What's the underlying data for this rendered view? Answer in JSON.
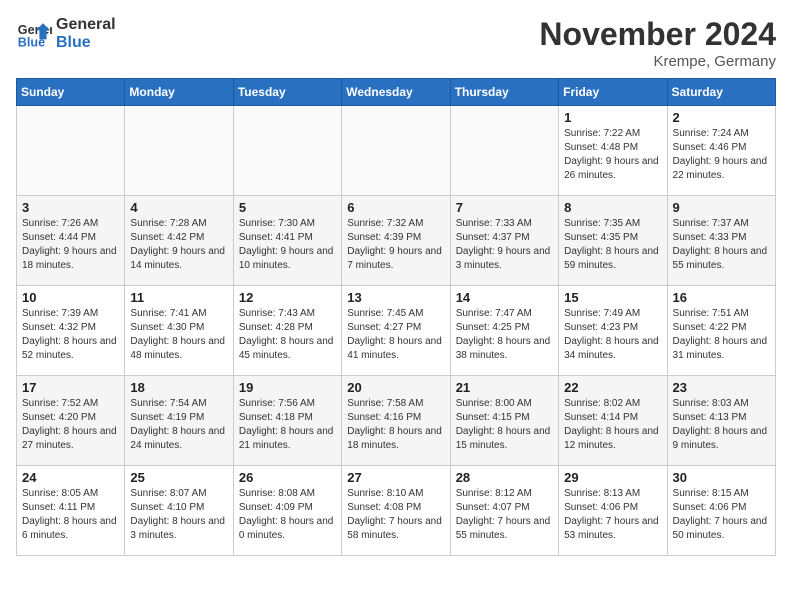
{
  "logo": {
    "text_general": "General",
    "text_blue": "Blue"
  },
  "header": {
    "month": "November 2024",
    "location": "Krempe, Germany"
  },
  "days_of_week": [
    "Sunday",
    "Monday",
    "Tuesday",
    "Wednesday",
    "Thursday",
    "Friday",
    "Saturday"
  ],
  "weeks": [
    [
      {
        "day": "",
        "info": ""
      },
      {
        "day": "",
        "info": ""
      },
      {
        "day": "",
        "info": ""
      },
      {
        "day": "",
        "info": ""
      },
      {
        "day": "",
        "info": ""
      },
      {
        "day": "1",
        "info": "Sunrise: 7:22 AM\nSunset: 4:48 PM\nDaylight: 9 hours and 26 minutes."
      },
      {
        "day": "2",
        "info": "Sunrise: 7:24 AM\nSunset: 4:46 PM\nDaylight: 9 hours and 22 minutes."
      }
    ],
    [
      {
        "day": "3",
        "info": "Sunrise: 7:26 AM\nSunset: 4:44 PM\nDaylight: 9 hours and 18 minutes."
      },
      {
        "day": "4",
        "info": "Sunrise: 7:28 AM\nSunset: 4:42 PM\nDaylight: 9 hours and 14 minutes."
      },
      {
        "day": "5",
        "info": "Sunrise: 7:30 AM\nSunset: 4:41 PM\nDaylight: 9 hours and 10 minutes."
      },
      {
        "day": "6",
        "info": "Sunrise: 7:32 AM\nSunset: 4:39 PM\nDaylight: 9 hours and 7 minutes."
      },
      {
        "day": "7",
        "info": "Sunrise: 7:33 AM\nSunset: 4:37 PM\nDaylight: 9 hours and 3 minutes."
      },
      {
        "day": "8",
        "info": "Sunrise: 7:35 AM\nSunset: 4:35 PM\nDaylight: 8 hours and 59 minutes."
      },
      {
        "day": "9",
        "info": "Sunrise: 7:37 AM\nSunset: 4:33 PM\nDaylight: 8 hours and 55 minutes."
      }
    ],
    [
      {
        "day": "10",
        "info": "Sunrise: 7:39 AM\nSunset: 4:32 PM\nDaylight: 8 hours and 52 minutes."
      },
      {
        "day": "11",
        "info": "Sunrise: 7:41 AM\nSunset: 4:30 PM\nDaylight: 8 hours and 48 minutes."
      },
      {
        "day": "12",
        "info": "Sunrise: 7:43 AM\nSunset: 4:28 PM\nDaylight: 8 hours and 45 minutes."
      },
      {
        "day": "13",
        "info": "Sunrise: 7:45 AM\nSunset: 4:27 PM\nDaylight: 8 hours and 41 minutes."
      },
      {
        "day": "14",
        "info": "Sunrise: 7:47 AM\nSunset: 4:25 PM\nDaylight: 8 hours and 38 minutes."
      },
      {
        "day": "15",
        "info": "Sunrise: 7:49 AM\nSunset: 4:23 PM\nDaylight: 8 hours and 34 minutes."
      },
      {
        "day": "16",
        "info": "Sunrise: 7:51 AM\nSunset: 4:22 PM\nDaylight: 8 hours and 31 minutes."
      }
    ],
    [
      {
        "day": "17",
        "info": "Sunrise: 7:52 AM\nSunset: 4:20 PM\nDaylight: 8 hours and 27 minutes."
      },
      {
        "day": "18",
        "info": "Sunrise: 7:54 AM\nSunset: 4:19 PM\nDaylight: 8 hours and 24 minutes."
      },
      {
        "day": "19",
        "info": "Sunrise: 7:56 AM\nSunset: 4:18 PM\nDaylight: 8 hours and 21 minutes."
      },
      {
        "day": "20",
        "info": "Sunrise: 7:58 AM\nSunset: 4:16 PM\nDaylight: 8 hours and 18 minutes."
      },
      {
        "day": "21",
        "info": "Sunrise: 8:00 AM\nSunset: 4:15 PM\nDaylight: 8 hours and 15 minutes."
      },
      {
        "day": "22",
        "info": "Sunrise: 8:02 AM\nSunset: 4:14 PM\nDaylight: 8 hours and 12 minutes."
      },
      {
        "day": "23",
        "info": "Sunrise: 8:03 AM\nSunset: 4:13 PM\nDaylight: 8 hours and 9 minutes."
      }
    ],
    [
      {
        "day": "24",
        "info": "Sunrise: 8:05 AM\nSunset: 4:11 PM\nDaylight: 8 hours and 6 minutes."
      },
      {
        "day": "25",
        "info": "Sunrise: 8:07 AM\nSunset: 4:10 PM\nDaylight: 8 hours and 3 minutes."
      },
      {
        "day": "26",
        "info": "Sunrise: 8:08 AM\nSunset: 4:09 PM\nDaylight: 8 hours and 0 minutes."
      },
      {
        "day": "27",
        "info": "Sunrise: 8:10 AM\nSunset: 4:08 PM\nDaylight: 7 hours and 58 minutes."
      },
      {
        "day": "28",
        "info": "Sunrise: 8:12 AM\nSunset: 4:07 PM\nDaylight: 7 hours and 55 minutes."
      },
      {
        "day": "29",
        "info": "Sunrise: 8:13 AM\nSunset: 4:06 PM\nDaylight: 7 hours and 53 minutes."
      },
      {
        "day": "30",
        "info": "Sunrise: 8:15 AM\nSunset: 4:06 PM\nDaylight: 7 hours and 50 minutes."
      }
    ]
  ]
}
